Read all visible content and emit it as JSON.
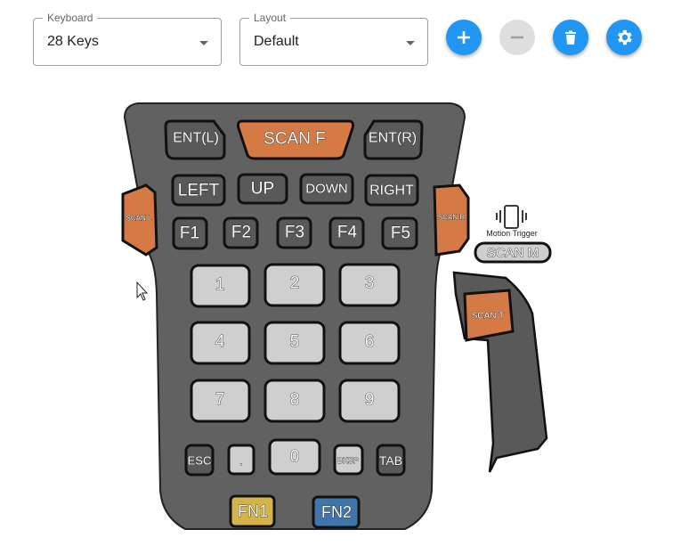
{
  "toolbar": {
    "keyboard": {
      "label": "Keyboard",
      "value": "28 Keys"
    },
    "layout": {
      "label": "Layout",
      "value": "Default"
    },
    "buttons": [
      {
        "name": "add",
        "icon": "plus-icon"
      },
      {
        "name": "remove",
        "icon": "minus-icon"
      },
      {
        "name": "delete",
        "icon": "trash-icon"
      },
      {
        "name": "settings",
        "icon": "gear-icon"
      }
    ]
  },
  "keys": {
    "ent_l": "ENT(L)",
    "scan_f": "SCAN F",
    "ent_r": "ENT(R)",
    "left": "LEFT",
    "up": "UP",
    "down": "DOWN",
    "right": "RIGHT",
    "f1": "F1",
    "f2": "F2",
    "f3": "F3",
    "f4": "F4",
    "f5": "F5",
    "n1": "1",
    "n2": "2",
    "n3": "3",
    "n4": "4",
    "n5": "5",
    "n6": "6",
    "n7": "7",
    "n8": "8",
    "n9": "9",
    "esc": "ESC",
    "dot": ".",
    "n0": "0",
    "bksp": "BKSP",
    "tab": "TAB",
    "fn1": "FN1",
    "fn2": "FN2",
    "scan_l": "SCAN L",
    "scan_r": "SCAN R",
    "scan_m": "SCAN M",
    "scan_t": "SCAN T"
  },
  "motion_trigger": {
    "label": "Motion Trigger",
    "icon": "vibration-icon"
  },
  "colors": {
    "accent": "#2196f3",
    "body": "#616161",
    "key_dark": "#595959",
    "key_light": "#cfcfcf",
    "scan": "#d57a44",
    "fn1": "#d4b44a",
    "fn2": "#3f75ad"
  }
}
